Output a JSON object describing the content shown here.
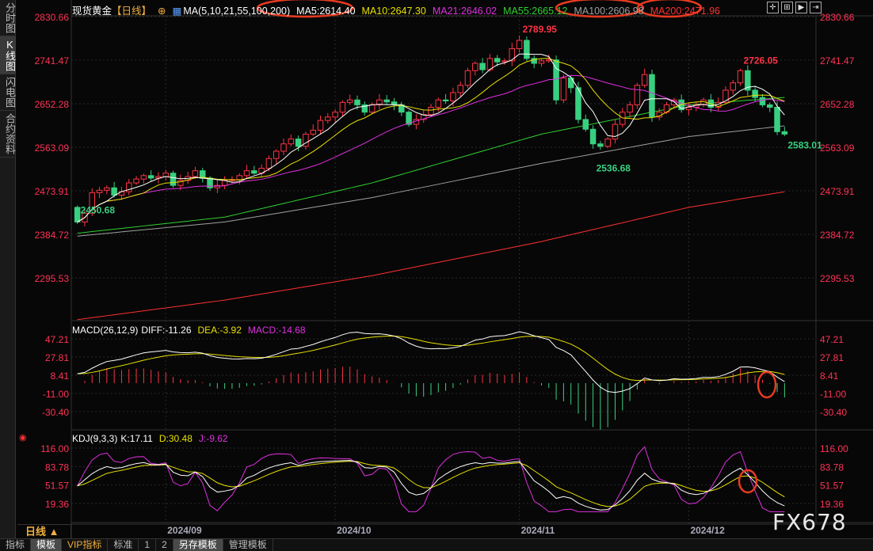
{
  "sidebar": {
    "tabs": [
      {
        "label": "分时图",
        "active": false
      },
      {
        "label": "K线图",
        "active": true
      },
      {
        "label": "闪电图",
        "active": false
      },
      {
        "label": "合约资料",
        "active": false
      }
    ]
  },
  "header": {
    "symbol": "现货黄金",
    "period": "【日线】",
    "ma_label": "MA(5,10,21,55,100,200)",
    "ma5": "MA5:2614.40",
    "ma10": "MA10:2647.30",
    "ma21": "MA21:2646.02",
    "ma55": "MA55:2665.12",
    "ma100": "MA100:2606.98",
    "ma200": "MA200:2471.96"
  },
  "toolbar_icons": [
    "crosshair-icon",
    "zoom-bars-icon",
    "play-icon",
    "move-right-icon"
  ],
  "macd_header": {
    "label": "MACD(26,12,9)",
    "diff": "DIFF:-11.26",
    "dea": "DEA:-3.92",
    "macd": "MACD:-14.68"
  },
  "kdj_header": {
    "label": "KDJ(9,3,3)",
    "k": "K:17.11",
    "d": "D:30.48",
    "j": "J:-9.62"
  },
  "period_button": "日线 ▲",
  "bottom_tabs": [
    {
      "label": "指标"
    },
    {
      "label": "模板",
      "selected": true
    },
    {
      "label": "VIP指标",
      "vip": true
    },
    {
      "label": "标准"
    },
    {
      "label": "1"
    },
    {
      "label": "2"
    },
    {
      "label": "另存模板",
      "selected": true
    },
    {
      "label": "管理模板"
    }
  ],
  "watermark": "FX678",
  "colors": {
    "up": "#ff3344",
    "down": "#38d080",
    "ma5": "#ffffff",
    "ma10": "#e8e000",
    "ma21": "#e030e0",
    "ma55": "#30d030",
    "ma100": "#a0a0a0",
    "ma200": "#ff3030",
    "axis": "#ff3355",
    "highlight": "#e83a20"
  },
  "chart_data": {
    "type": "candlestick",
    "price_axis_ticks": [
      "2830.66",
      "2741.47",
      "2652.28",
      "2563.09",
      "2473.91",
      "2384.72",
      "2295.53"
    ],
    "price_range": [
      2295.53,
      2830.66
    ],
    "closes": [
      2410,
      2428,
      2470,
      2475,
      2480,
      2465,
      2472,
      2490,
      2498,
      2505,
      2500,
      2503,
      2510,
      2485,
      2495,
      2503,
      2515,
      2500,
      2480,
      2485,
      2495,
      2497,
      2505,
      2515,
      2510,
      2520,
      2540,
      2555,
      2570,
      2580,
      2565,
      2590,
      2598,
      2618,
      2625,
      2635,
      2655,
      2660,
      2650,
      2635,
      2650,
      2660,
      2656,
      2650,
      2635,
      2610,
      2620,
      2630,
      2645,
      2660,
      2658,
      2675,
      2690,
      2720,
      2735,
      2722,
      2745,
      2738,
      2740,
      2765,
      2782,
      2745,
      2735,
      2740,
      2742,
      2660,
      2705,
      2685,
      2620,
      2600,
      2570,
      2565,
      2580,
      2610,
      2635,
      2650,
      2690,
      2712,
      2625,
      2635,
      2650,
      2660,
      2640,
      2645,
      2650,
      2660,
      2645,
      2655,
      2680,
      2695,
      2720,
      2680,
      2665,
      2650,
      2645,
      2595,
      2590
    ],
    "first_open": 2440,
    "ma55": [
      [
        0,
        2387
      ],
      [
        20,
        2420
      ],
      [
        40,
        2490
      ],
      [
        63,
        2590
      ],
      [
        83,
        2650
      ],
      [
        96,
        2665.12
      ]
    ],
    "ma100": [
      [
        0,
        2381
      ],
      [
        20,
        2410
      ],
      [
        40,
        2460
      ],
      [
        63,
        2530
      ],
      [
        83,
        2585
      ],
      [
        96,
        2606.98
      ]
    ],
    "ma200": [
      [
        0,
        2210
      ],
      [
        20,
        2250
      ],
      [
        40,
        2300
      ],
      [
        63,
        2370
      ],
      [
        83,
        2440
      ],
      [
        96,
        2471.96
      ]
    ],
    "annotations": [
      {
        "bar": 60,
        "price": 2789.95,
        "text": "2789.95",
        "color": "up",
        "pos": "above"
      },
      {
        "bar": 70,
        "price": 2536.68,
        "text": "2536.68",
        "color": "down",
        "pos": "below"
      },
      {
        "bar": 0,
        "price": 2450.68,
        "text": "2450.68",
        "color": "down",
        "pos": "below"
      },
      {
        "bar": 90,
        "price": 2726.05,
        "text": "2726.05",
        "color": "up",
        "pos": "above"
      },
      {
        "bar": 96,
        "price": 2583.01,
        "text": "2583.01",
        "color": "down",
        "pos": "below"
      }
    ],
    "x_ticks": [
      {
        "bar": 12,
        "label": "2024/09"
      },
      {
        "bar": 35,
        "label": "2024/10"
      },
      {
        "bar": 60,
        "label": "2024/11"
      },
      {
        "bar": 83,
        "label": "2024/12"
      }
    ],
    "macd_axis_ticks": [
      "47.21",
      "27.81",
      "8.41",
      "-11.00",
      "-30.40"
    ],
    "macd_range": [
      -30.4,
      47.21
    ],
    "kdj_axis_ticks": [
      "116.00",
      "83.78",
      "51.57",
      "19.36"
    ],
    "kdj_range": [
      19.36,
      116.0
    ]
  }
}
